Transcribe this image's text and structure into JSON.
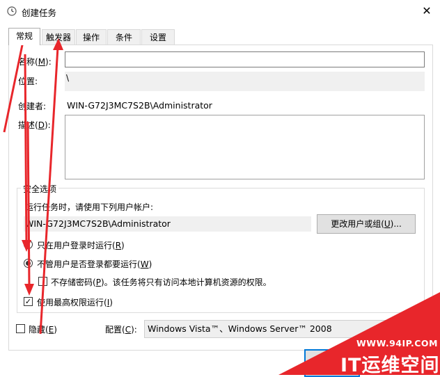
{
  "window": {
    "title": "创建任务",
    "close_symbol": "✕"
  },
  "tabs": [
    {
      "label": "常规",
      "active": true
    },
    {
      "label": "触发器",
      "active": false
    },
    {
      "label": "操作",
      "active": false
    },
    {
      "label": "条件",
      "active": false
    },
    {
      "label": "设置",
      "active": false
    }
  ],
  "general": {
    "name_label": "名称(",
    "name_key": "M",
    "name_label_end": "):",
    "name_value": "",
    "location_label": "位置:",
    "location_value": "\\",
    "author_label": "创建者:",
    "author_value": "WIN-G72J3MC7S2B\\Administrator",
    "desc_label": "描述(",
    "desc_key": "D",
    "desc_label_end": "):",
    "desc_value": ""
  },
  "security": {
    "group_title": "安全选项",
    "run_as_text": "运行任务时，请使用下列用户帐户:",
    "user_account": "WIN-G72J3MC7S2B\\Administrator",
    "change_user_button": "更改用户或组(",
    "change_user_key": "U",
    "change_user_end": ")...",
    "radio_logged_on": "只在用户登录时运行(",
    "radio_logged_on_key": "R",
    "radio_logged_on_end": ")",
    "radio_whether": "不管用户是否登录都要运行(",
    "radio_whether_key": "W",
    "radio_whether_end": ")",
    "radio_selected": "whether",
    "no_store_password": "不存储密码(",
    "no_store_password_key": "P",
    "no_store_password_end": ")。该任务将只有访问本地计算机资源的权限。",
    "no_store_password_checked": false,
    "highest_privileges": "使用最高权限运行(",
    "highest_privileges_key": "I",
    "highest_privileges_end": ")",
    "highest_privileges_checked": true
  },
  "footer": {
    "hidden_label": "隐藏(",
    "hidden_key": "E",
    "hidden_end": ")",
    "hidden_checked": false,
    "configure_label": "配置(",
    "configure_key": "C",
    "configure_end": "):",
    "configure_value": "Windows Vista™、Windows Server™ 2008"
  },
  "watermark": {
    "url": "WWW.94IP.COM",
    "brand": "IT运维空间"
  },
  "colors": {
    "accent": "#0078d7",
    "annotation_red": "#e8262b"
  }
}
